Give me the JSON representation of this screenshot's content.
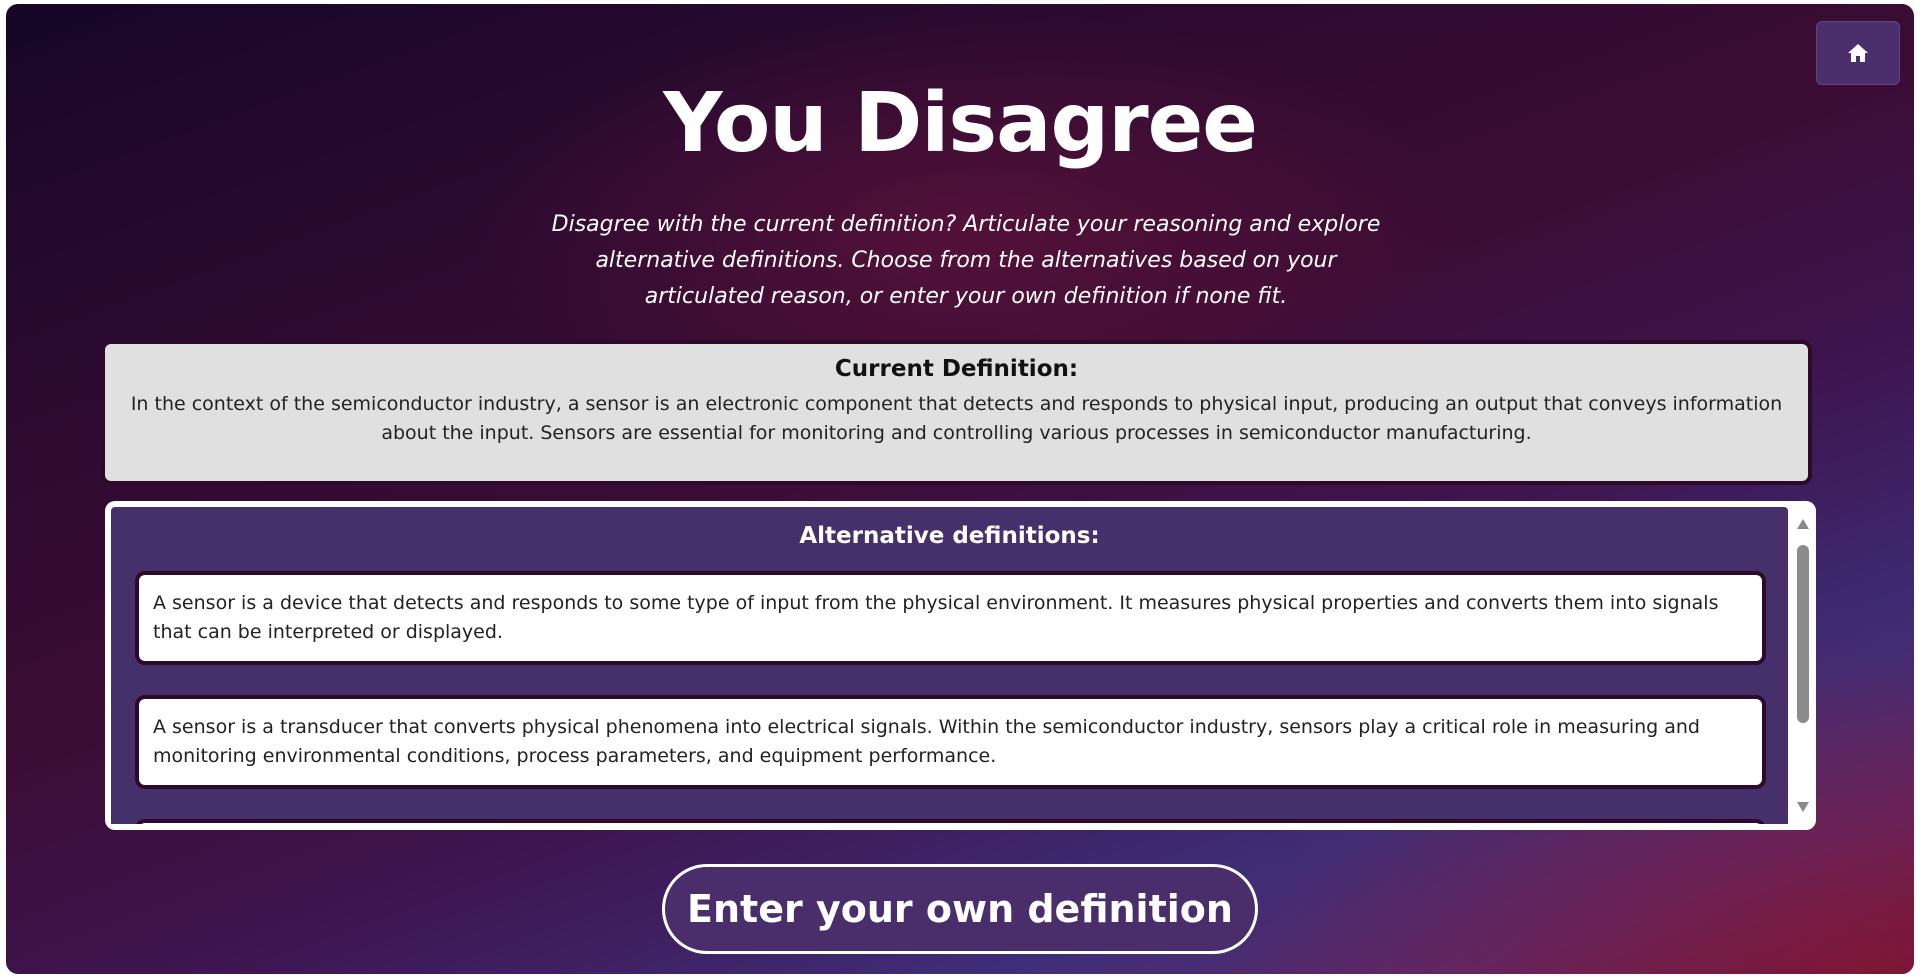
{
  "header": {
    "title": "You Disagree",
    "subtitle": "Disagree with the current definition? Articulate your reasoning and explore alternative definitions. Choose from the alternatives based on your articulated reason, or enter your own definition if none fit.",
    "home_icon": "home-icon"
  },
  "current_definition": {
    "heading": "Current Definition:",
    "text": "In the context of the semiconductor industry, a sensor is an electronic component that detects and responds to physical input, producing an output that conveys information about the input. Sensors are essential for monitoring and controlling various processes in semiconductor manufacturing."
  },
  "alternatives": {
    "heading": "Alternative definitions:",
    "items": [
      "A sensor is a device that detects and responds to some type of input from the physical environment. It measures physical properties and converts them into signals that can be interpreted or displayed.",
      "A sensor is a transducer that converts physical phenomena into electrical signals. Within the semiconductor industry, sensors play a critical role in measuring and monitoring environmental conditions, process parameters, and equipment performance.",
      ""
    ]
  },
  "actions": {
    "own_definition_label": "Enter your own definition"
  },
  "colors": {
    "accent_purple": "#46306c",
    "card_border": "#2e0a2a",
    "current_def_bg": "#e0e0e0"
  }
}
